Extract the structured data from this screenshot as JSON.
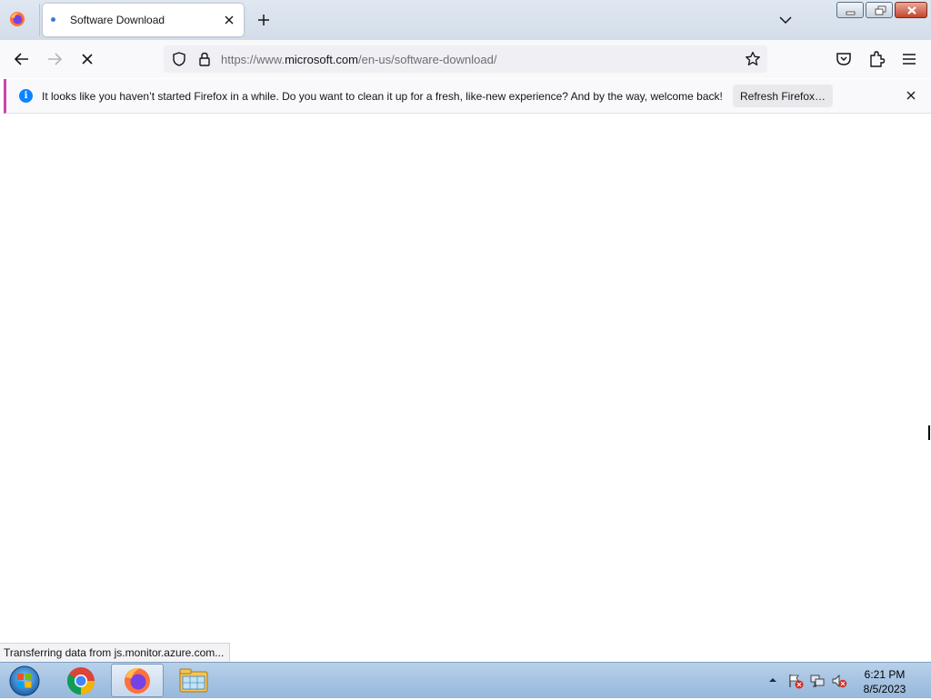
{
  "browser": {
    "tab": {
      "title": "Software Download"
    },
    "url": {
      "prefix": "https://www.",
      "domain": "microsoft.com",
      "path": "/en-us/software-download/"
    }
  },
  "notification": {
    "message": "It looks like you haven’t started Firefox in a while. Do you want to clean it up for a fresh, like-new experience? And by the way, welcome back!",
    "button_label": "Refresh Firefox…"
  },
  "status_text": "Transferring data from js.monitor.azure.com...",
  "taskbar": {
    "apps": [
      "chrome-icon",
      "firefox-icon",
      "file-explorer-icon"
    ],
    "clock": {
      "time": "6:21 PM",
      "date": "8/5/2023"
    }
  },
  "colors": {
    "accent": "#0a84ff",
    "notification_stripe": "#c847a8",
    "taskbar": "#a6c3e2"
  }
}
